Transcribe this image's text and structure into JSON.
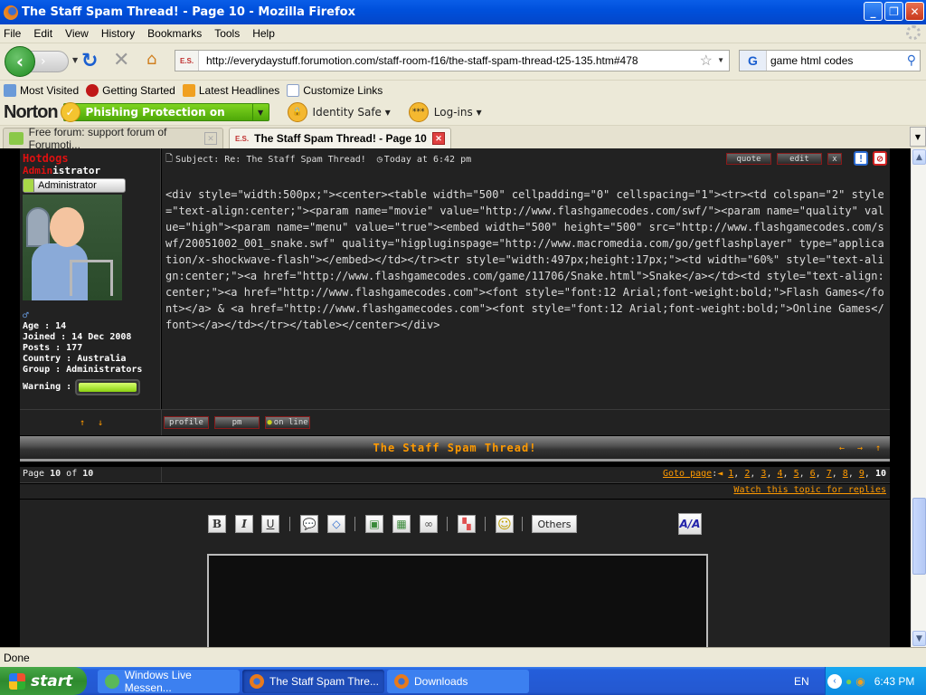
{
  "window": {
    "title": "The Staff Spam Thread! - Page 10 - Mozilla Firefox",
    "minimize": "_",
    "restore": "❐",
    "close": "✕"
  },
  "menu": [
    "File",
    "Edit",
    "View",
    "History",
    "Bookmarks",
    "Tools",
    "Help"
  ],
  "nav": {
    "url": "http://everydaystuff.forumotion.com/staff-room-f16/the-staff-spam-thread-t25-135.htm#478",
    "site_icon_text": "E.S.",
    "search_engine": "G",
    "search_value": "game html codes"
  },
  "bookmarks": [
    {
      "label": "Most Visited",
      "icon": "folder-search-icon",
      "color": "#6a9ad8"
    },
    {
      "label": "Getting Started",
      "icon": "firefox-red-icon",
      "color": "#c01818"
    },
    {
      "label": "Latest Headlines",
      "icon": "rss-icon",
      "color": "#f0a020"
    },
    {
      "label": "Customize Links",
      "icon": "page-icon",
      "color": "#e8eef8"
    }
  ],
  "norton": {
    "logo": "Norton",
    "phishing": "Phishing Protection on",
    "identity_safe": "Identity Safe",
    "logins": "Log-ins"
  },
  "tabs": [
    {
      "label": "Free forum: support forum of Forumoti...",
      "active": false
    },
    {
      "label": "The Staff Spam Thread! - Page 10",
      "active": true
    }
  ],
  "post": {
    "username": "Hotdogs",
    "rank_red": "Admin",
    "rank_rest": "istrator",
    "rank_badge": "Administrator",
    "gender_icon": "♂",
    "stats": [
      "Age : 14",
      "Joined : 14 Dec 2008",
      "Posts : 177",
      "Country : Australia",
      "Group : Administrators"
    ],
    "warning_label": "Warning :",
    "warning_level": 0,
    "subject": "Subject: Re: The Staff Spam Thread!",
    "time": "Today at 6:42 pm",
    "buttons": {
      "quote": "quote",
      "edit": "edit",
      "delete": "x",
      "report": "!",
      "ip": "⊘"
    },
    "body": "<div style=\"width:500px;\"><center><table width=\"500\" cellpadding=\"0\" cellspacing=\"1\"><tr><td colspan=\"2\" style=\"text-align:center;\"><param name=\"movie\" value=\"http://www.flashgamecodes.com/swf/\"><param name=\"quality\" value=\"high\"><param name=\"menu\" value=\"true\"><embed width=\"500\" height=\"500\" src=\"http://www.flashgamecodes.com/swf/20051002_001_snake.swf\" quality=\"higpluginspage=\"http://www.macromedia.com/go/getflashplayer\" type=\"application/x-shockwave-flash\"></embed></td></tr><tr style=\"width:497px;height:17px;\"><td width=\"60%\" style=\"text-align:center;\"><a href=\"http://www.flashgamecodes.com/game/11706/Snake.html\">Snake</a></td><td style=\"text-align:center;\"><a href=\"http://www.flashgamecodes.com\"><font style=\"font:12 Arial;font-weight:bold;\">Flash Games</font></a> & <a href=\"http://www.flashgamecodes.com\"><font style=\"font:12 Arial;font-weight:bold;\">Online Games</font></a></td></tr></table></center></div>",
    "footer_buttons": {
      "profile": "profile",
      "pm": "pm",
      "online": "on line"
    },
    "nav_arrows": "↑ ↓"
  },
  "thread": {
    "title": "The Staff Spam Thread!",
    "nav": "← → ↑"
  },
  "pager": {
    "prefix": "Page ",
    "current": "10",
    "of": " of ",
    "total": "10",
    "goto_label": "Goto page",
    "separator": " : ",
    "prev_arrow": "◄",
    "pages": [
      "1",
      "2",
      "3",
      "4",
      "5",
      "6",
      "7",
      "8",
      "9"
    ],
    "current_page": "10",
    "watch": "Watch this topic for replies"
  },
  "editor": {
    "buttons": [
      {
        "name": "bold-button",
        "label": "B"
      },
      {
        "name": "italic-button",
        "label": "I"
      },
      {
        "name": "underline-button",
        "label": "U"
      },
      {
        "name": "quote-button",
        "label": "💬"
      },
      {
        "name": "code-button",
        "label": "◇"
      },
      {
        "name": "upload-image-button",
        "label": "▣"
      },
      {
        "name": "image-button",
        "label": "▦"
      },
      {
        "name": "link-button",
        "label": "∞"
      },
      {
        "name": "color-button",
        "label": "▚"
      },
      {
        "name": "smiley-button",
        "label": "☺"
      }
    ],
    "others": "Others",
    "font_btn": "A/A"
  },
  "status": "Done",
  "taskbar": {
    "start": "start",
    "tasks": [
      {
        "label": "Windows Live Messen...",
        "active": false
      },
      {
        "label": "The Staff Spam Thre...",
        "active": true
      },
      {
        "label": "Downloads",
        "active": false
      }
    ],
    "lang": "EN",
    "clock": "6:43 PM"
  }
}
